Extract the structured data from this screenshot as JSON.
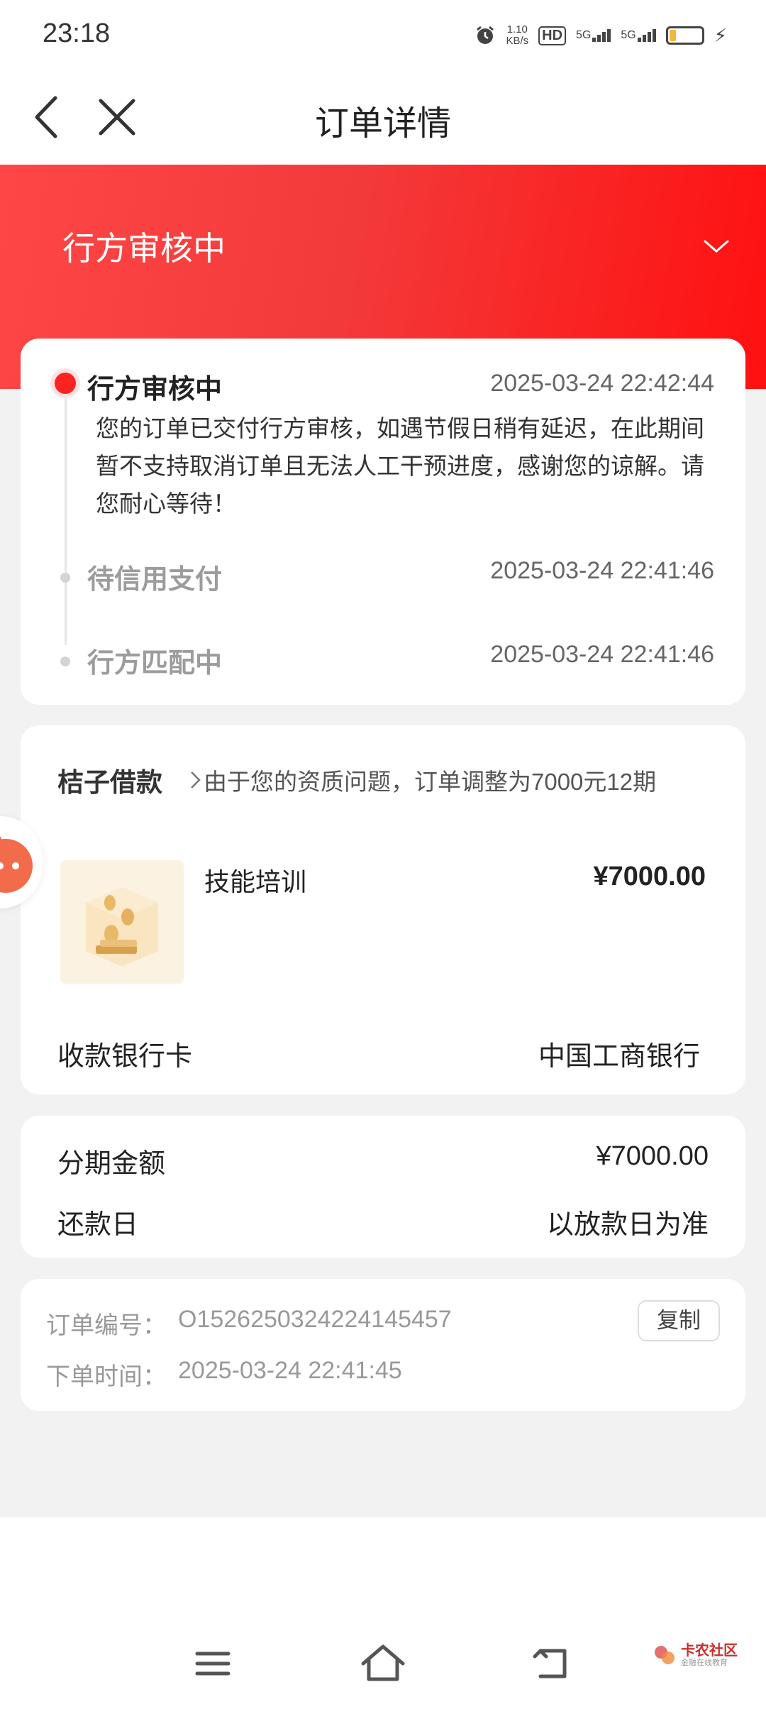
{
  "status_bar": {
    "time": "23:18",
    "speed_value": "1.10",
    "speed_unit": "KB/s",
    "hd_label": "HD",
    "net1": "5G",
    "net2": "5G",
    "battery_level": 0.2,
    "icons": [
      "alarm-icon",
      "battery-icon",
      "charging-icon"
    ]
  },
  "nav": {
    "title": "订单详情"
  },
  "banner": {
    "status": "行方审核中"
  },
  "timeline": {
    "steps": [
      {
        "title": "行方审核中",
        "time": "2025-03-24 22:42:44",
        "description": "您的订单已交付行方审核，如遇节假日稍有延迟，在此期间暂不支持取消订单且无法人工干预进度，感谢您的谅解。请您耐心等待！"
      },
      {
        "title": "待信用支付",
        "time": "2025-03-24 22:41:46"
      },
      {
        "title": "行方匹配中",
        "time": "2025-03-24 22:41:46"
      }
    ]
  },
  "product": {
    "shop_name": "桔子借款",
    "note": "由于您的资质问题，订单调整为7000元12期",
    "item_name": "技能培训",
    "price": "¥7000.00",
    "bank_label": "收款银行卡",
    "bank_value": "中国工商银行"
  },
  "amount": {
    "installment_label": "分期金额",
    "installment_value": "¥7000.00",
    "repay_label": "还款日",
    "repay_value": "以放款日为准"
  },
  "order": {
    "number_label": "订单编号：",
    "number_value": "O1526250324224145457",
    "time_label": "下单时间：",
    "time_value": "2025-03-24 22:41:45",
    "copy_label": "复制"
  },
  "watermark": {
    "name": "卡农社区",
    "sub": "金融在线教育"
  },
  "colors": {
    "accent_red": "#ff2222",
    "banner_start": "#ff4646",
    "banner_end": "#ff1010",
    "page_bg": "#f2f2f2"
  }
}
